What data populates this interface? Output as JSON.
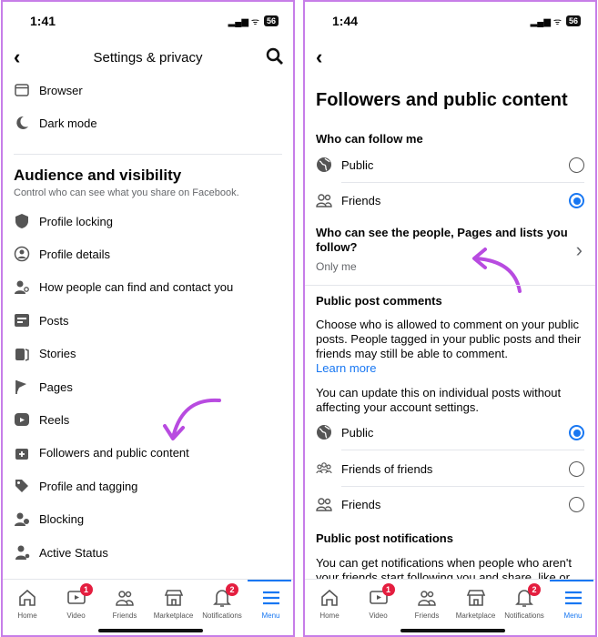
{
  "left": {
    "time": "1:41",
    "battery": "56",
    "title": "Settings & privacy",
    "top_items": [
      {
        "label": "Browser",
        "icon": "browser-icon"
      },
      {
        "label": "Dark mode",
        "icon": "moon-icon"
      }
    ],
    "section": {
      "title": "Audience and visibility",
      "subtitle": "Control who can see what you share on Facebook."
    },
    "items": [
      {
        "label": "Profile locking",
        "icon": "shield-icon"
      },
      {
        "label": "Profile details",
        "icon": "person-circle-icon"
      },
      {
        "label": "How people can find and contact you",
        "icon": "person-search-icon"
      },
      {
        "label": "Posts",
        "icon": "posts-icon"
      },
      {
        "label": "Stories",
        "icon": "stories-icon"
      },
      {
        "label": "Pages",
        "icon": "flag-icon"
      },
      {
        "label": "Reels",
        "icon": "reels-icon"
      },
      {
        "label": "Followers and public content",
        "icon": "followers-icon"
      },
      {
        "label": "Profile and tagging",
        "icon": "tag-icon"
      },
      {
        "label": "Blocking",
        "icon": "block-user-icon"
      },
      {
        "label": "Active Status",
        "icon": "active-status-icon"
      }
    ]
  },
  "right": {
    "time": "1:44",
    "battery": "56",
    "title": "Followers and public content",
    "follow": {
      "heading": "Who can follow me",
      "options": [
        {
          "label": "Public",
          "selected": false
        },
        {
          "label": "Friends",
          "selected": true
        }
      ]
    },
    "question": {
      "text": "Who can see the people, Pages and lists you follow?",
      "value": "Only me"
    },
    "comments": {
      "heading": "Public post comments",
      "desc": "Choose who is allowed to comment on your public posts. People tagged in your public posts and their friends may still be able to comment.",
      "link": "Learn more",
      "note": "You can update this on individual posts without affecting your account settings.",
      "options": [
        {
          "label": "Public",
          "selected": true
        },
        {
          "label": "Friends of friends",
          "selected": false
        },
        {
          "label": "Friends",
          "selected": false
        }
      ]
    },
    "notifications": {
      "heading": "Public post notifications",
      "desc": "You can get notifications when people who aren't your friends start following you and share, like or"
    }
  },
  "tabs": [
    {
      "label": "Home",
      "badge": ""
    },
    {
      "label": "Video",
      "badge": "1"
    },
    {
      "label": "Friends",
      "badge": ""
    },
    {
      "label": "Marketplace",
      "badge": ""
    },
    {
      "label": "Notifications",
      "badge": "2"
    },
    {
      "label": "Menu",
      "badge": ""
    }
  ],
  "colors": {
    "accent": "#1877f2",
    "badge": "#e41e3f",
    "arrow": "#b84be0"
  }
}
